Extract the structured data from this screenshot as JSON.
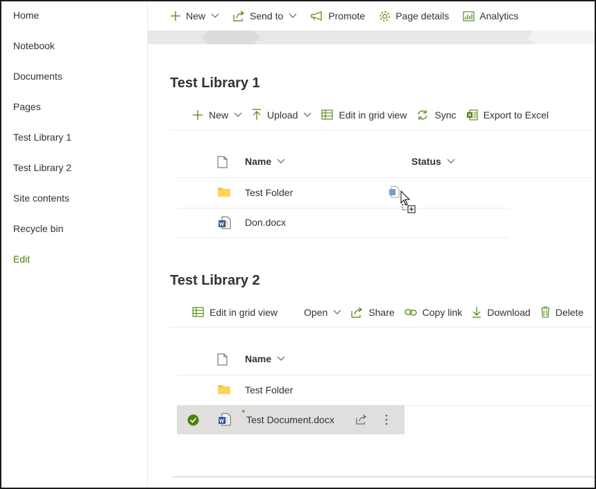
{
  "nav": {
    "items": [
      "Home",
      "Notebook",
      "Documents",
      "Pages",
      "Test Library 1",
      "Test Library 2",
      "Site contents",
      "Recycle bin"
    ],
    "edit": "Edit"
  },
  "cmdbar": {
    "new": "New",
    "send_to": "Send to",
    "promote": "Promote",
    "page_details": "Page details",
    "analytics": "Analytics"
  },
  "library1": {
    "title": "Test Library 1",
    "toolbar": {
      "new": "New",
      "upload": "Upload",
      "edit_grid": "Edit in grid view",
      "sync": "Sync",
      "export": "Export to Excel"
    },
    "columns": {
      "name": "Name",
      "status": "Status"
    },
    "rows": [
      {
        "name": "Test Folder",
        "icon": "folder-icon"
      },
      {
        "name": "Don.docx",
        "icon": "word-icon"
      }
    ]
  },
  "library2": {
    "title": "Test Library 2",
    "toolbar": {
      "edit_grid": "Edit in grid view",
      "open": "Open",
      "share": "Share",
      "copy_link": "Copy link",
      "download": "Download",
      "delete": "Delete"
    },
    "columns": {
      "name": "Name"
    },
    "rows": [
      {
        "name": "Test Folder",
        "icon": "folder-icon"
      },
      {
        "name": "Test Document.docx",
        "icon": "word-icon",
        "selected": true
      }
    ]
  },
  "colors": {
    "accent": "#498205",
    "selected_row": "#e1dfdd",
    "folder": "#f5c24a",
    "word": "#2b579a"
  }
}
